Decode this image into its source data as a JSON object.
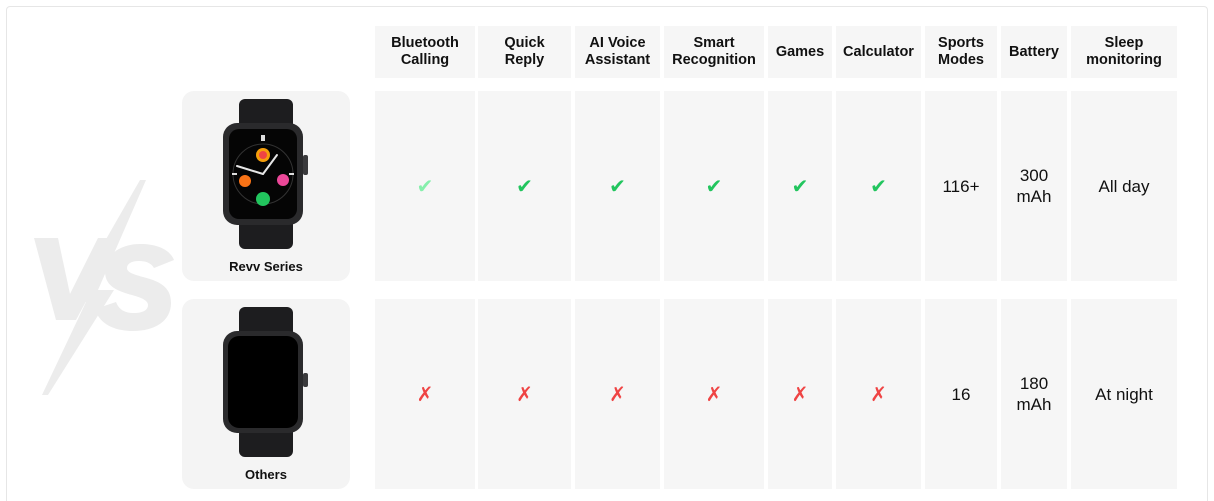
{
  "columns": [
    {
      "label": "Bluetooth\nCalling"
    },
    {
      "label": "Quick\nReply"
    },
    {
      "label": "AI Voice\nAssistant"
    },
    {
      "label": "Smart\nRecognition"
    },
    {
      "label": "Games"
    },
    {
      "label": "Calculator"
    },
    {
      "label": "Sports\nModes"
    },
    {
      "label": "Battery"
    },
    {
      "label": "Sleep\nmonitoring"
    }
  ],
  "products": [
    {
      "name": "Revv Series",
      "values": [
        "✔",
        "✔",
        "✔",
        "✔",
        "✔",
        "✔",
        "116+",
        "300\nmAh",
        "All day"
      ]
    },
    {
      "name": "Others",
      "values": [
        "✗",
        "✗",
        "✗",
        "✗",
        "✗",
        "✗",
        "16",
        "180\nmAh",
        "At night"
      ]
    }
  ],
  "colors": {
    "check": "#22c55e",
    "check_light": "#86efac",
    "cross": "#ef4444",
    "cell_bg": "#f6f6f6"
  },
  "watermark": "VS"
}
